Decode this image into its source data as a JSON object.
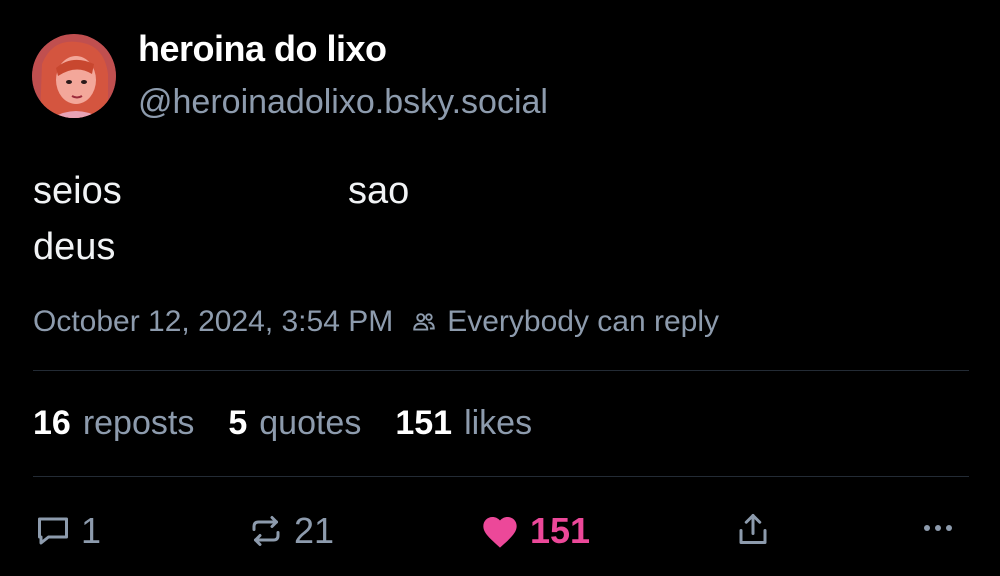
{
  "post": {
    "author": {
      "display_name": "heroina do lixo",
      "handle": "@heroinadolixo.bsky.social"
    },
    "text_words": [
      "seios",
      "sao",
      "deus"
    ],
    "timestamp": "October 12, 2024, 3:54 PM",
    "reply_setting": "Everybody can reply",
    "stats": [
      {
        "count": "16",
        "label": "reposts"
      },
      {
        "count": "5",
        "label": "quotes"
      },
      {
        "count": "151",
        "label": "likes"
      }
    ],
    "actions": {
      "reply_count": "1",
      "repost_count": "21",
      "like_count": "151"
    },
    "colors": {
      "background": "#000000",
      "muted_text": "#8d9bad",
      "like_pink": "#ec4899",
      "divider": "#232b35"
    },
    "icons": [
      "people-icon",
      "reply-icon",
      "repost-icon",
      "heart-icon",
      "share-icon",
      "more-icon"
    ]
  }
}
